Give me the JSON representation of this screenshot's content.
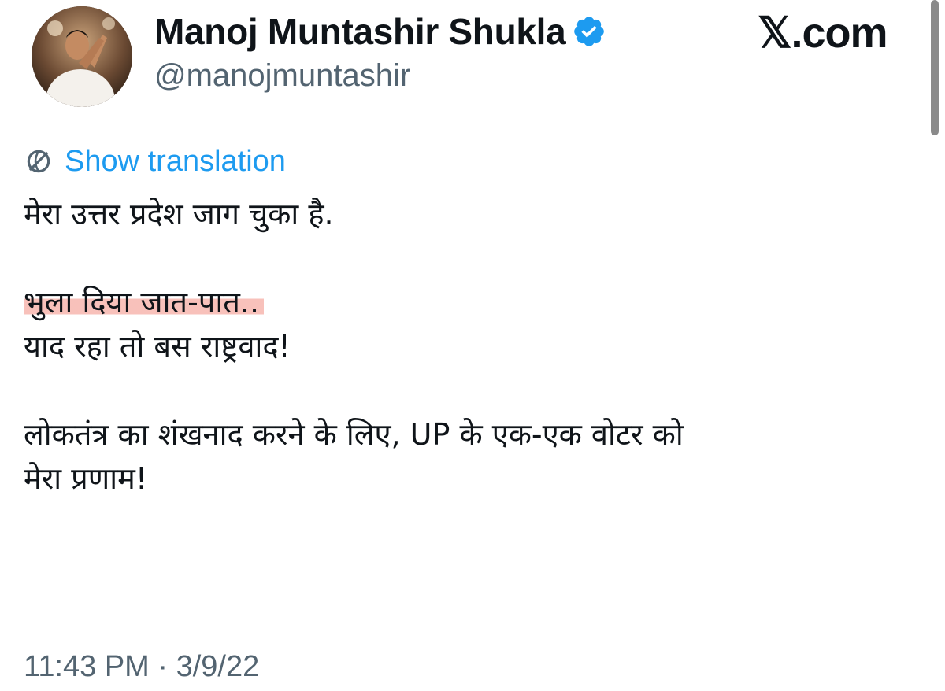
{
  "tweet": {
    "author": {
      "display_name": "Manoj Muntashir Shukla",
      "handle": "@manojmuntashir",
      "verified": true,
      "avatar_icon": "profile-photo"
    },
    "brand": "𝕏.com",
    "translate_label": "Show translation",
    "lines": [
      "मेरा उत्तर प्रदेश जाग चुका है.",
      "",
      "भुला दिया जात-पात..",
      "याद रहा तो बस राष्ट्रवाद!",
      "",
      "लोकतंत्र का शंखनाद करने के लिए, UP के एक-एक वोटर को",
      "मेरा प्रणाम!"
    ],
    "highlighted_line_index": 2,
    "timestamp": "11:43 PM · 3/9/22"
  },
  "colors": {
    "text": "#0f1419",
    "secondary": "#536471",
    "link": "#1d9bf0",
    "verified": "#1d9bf0",
    "highlight": "#f4a096"
  }
}
